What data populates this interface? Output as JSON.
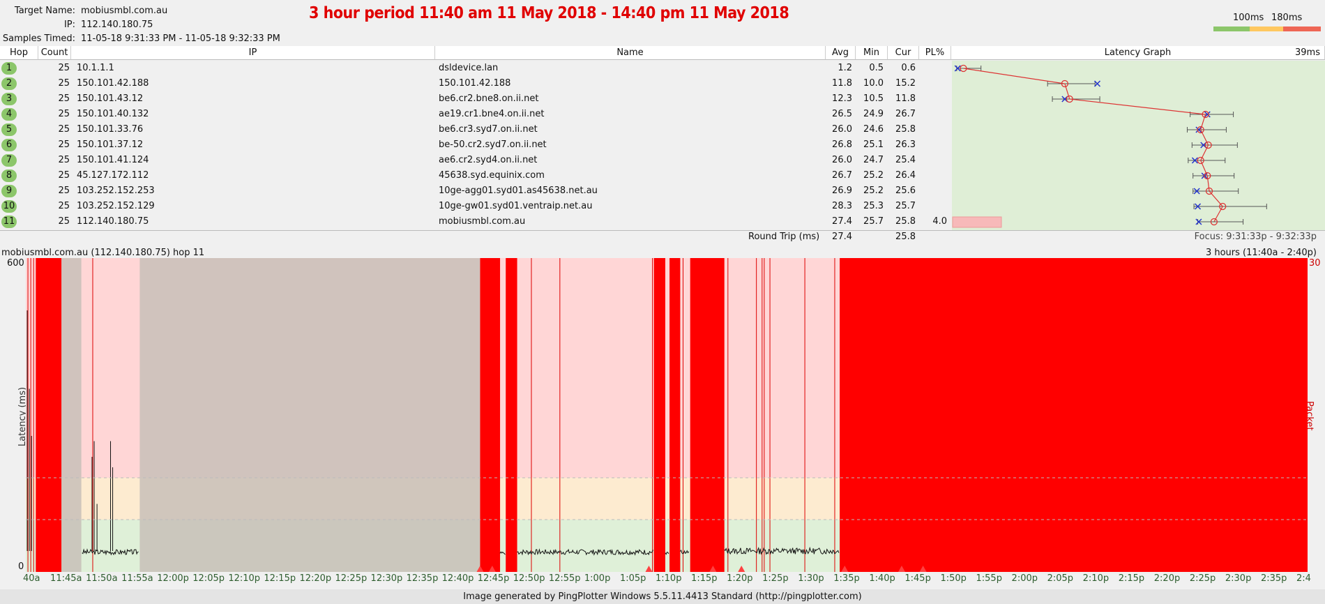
{
  "header": {
    "target_label": "Target Name:",
    "target_value": "mobiusmbl.com.au",
    "ip_label": "IP:",
    "ip_value": "112.140.180.75",
    "samples_label": "Samples Timed:",
    "samples_value": "11-05-18 9:31:33 PM - 11-05-18 9:32:33 PM",
    "banner": "3 hour period 11:40 am 11 May 2018 - 14:40 pm 11 May 2018",
    "legend_100": "100ms",
    "legend_180": "180ms"
  },
  "colors": {
    "green": "#8cc66a",
    "yellow": "#ffc860",
    "red_legend": "#ee6655",
    "graph_bg": "#dfeed6",
    "loss_red": "#ff0000"
  },
  "table": {
    "columns": [
      "Hop",
      "Count",
      "IP",
      "Name",
      "Avg",
      "Min",
      "Cur",
      "PL%",
      "Latency Graph"
    ],
    "graph_max": "39ms",
    "rows": [
      {
        "hop": "1",
        "count": "25",
        "ip": "10.1.1.1",
        "name": "dsldevice.lan",
        "avg": "1.2",
        "min": "0.5",
        "cur": "0.6",
        "pl": ""
      },
      {
        "hop": "2",
        "count": "25",
        "ip": "150.101.42.188",
        "name": "150.101.42.188",
        "avg": "11.8",
        "min": "10.0",
        "cur": "15.2",
        "pl": ""
      },
      {
        "hop": "3",
        "count": "25",
        "ip": "150.101.43.12",
        "name": "be6.cr2.bne8.on.ii.net",
        "avg": "12.3",
        "min": "10.5",
        "cur": "11.8",
        "pl": ""
      },
      {
        "hop": "4",
        "count": "25",
        "ip": "150.101.40.132",
        "name": "ae19.cr1.bne4.on.ii.net",
        "avg": "26.5",
        "min": "24.9",
        "cur": "26.7",
        "pl": ""
      },
      {
        "hop": "5",
        "count": "25",
        "ip": "150.101.33.76",
        "name": "be6.cr3.syd7.on.ii.net",
        "avg": "26.0",
        "min": "24.6",
        "cur": "25.8",
        "pl": ""
      },
      {
        "hop": "6",
        "count": "25",
        "ip": "150.101.37.12",
        "name": "be-50.cr2.syd7.on.ii.net",
        "avg": "26.8",
        "min": "25.1",
        "cur": "26.3",
        "pl": ""
      },
      {
        "hop": "7",
        "count": "25",
        "ip": "150.101.41.124",
        "name": "ae6.cr2.syd4.on.ii.net",
        "avg": "26.0",
        "min": "24.7",
        "cur": "25.4",
        "pl": ""
      },
      {
        "hop": "8",
        "count": "25",
        "ip": "45.127.172.112",
        "name": "45638.syd.equinix.com",
        "avg": "26.7",
        "min": "25.2",
        "cur": "26.4",
        "pl": ""
      },
      {
        "hop": "9",
        "count": "25",
        "ip": "103.252.152.253",
        "name": "10ge-agg01.syd01.as45638.net.au",
        "avg": "26.9",
        "min": "25.2",
        "cur": "25.6",
        "pl": ""
      },
      {
        "hop": "10",
        "count": "25",
        "ip": "103.252.152.129",
        "name": "10ge-gw01.syd01.ventraip.net.au",
        "avg": "28.3",
        "min": "25.3",
        "cur": "25.7",
        "pl": ""
      },
      {
        "hop": "11",
        "count": "25",
        "ip": "112.140.180.75",
        "name": "mobiusmbl.com.au",
        "avg": "27.4",
        "min": "25.7",
        "cur": "25.8",
        "pl": "4.0"
      }
    ],
    "round_trip_label": "Round Trip (ms)",
    "round_trip_avg": "27.4",
    "round_trip_cur": "25.8",
    "focus": "Focus: 9:31:33p - 9:32:33p"
  },
  "graph": {
    "title": "mobiusmbl.com.au (112.140.180.75) hop 11",
    "range": "3 hours (11:40a - 2:40p)",
    "y_top": "600",
    "y_bottom": "0",
    "y_label": "Latency (ms)",
    "right_top": "30",
    "right_label": "Packet Loss %",
    "x_labels": [
      "40a",
      "11:45a",
      "11:50a",
      "11:55a",
      "12:00p",
      "12:05p",
      "12:10p",
      "12:15p",
      "12:20p",
      "12:25p",
      "12:30p",
      "12:35p",
      "12:40p",
      "12:45p",
      "12:50p",
      "12:55p",
      "1:00p",
      "1:05p",
      "1:10p",
      "1:15p",
      "1:20p",
      "1:25p",
      "1:30p",
      "1:35p",
      "1:40p",
      "1:45p",
      "1:50p",
      "1:55p",
      "2:00p",
      "2:05p",
      "2:10p",
      "2:15p",
      "2:20p",
      "2:25p",
      "2:30p",
      "2:35p",
      "2:4"
    ]
  },
  "footer": "Image generated by PingPlotter Windows 5.5.11.4413 Standard (http://pingplotter.com)"
}
